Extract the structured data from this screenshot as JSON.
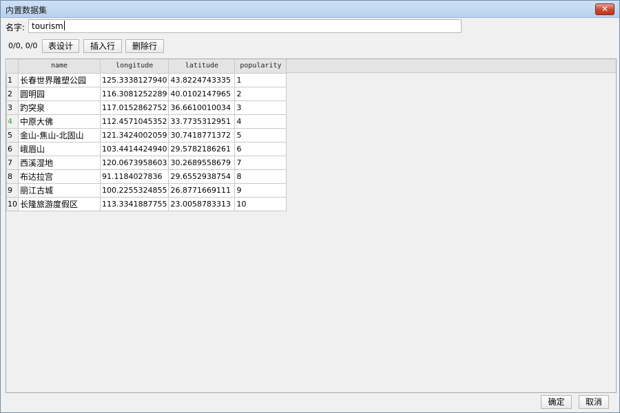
{
  "window": {
    "title": "内置数据集",
    "close_label": "✕"
  },
  "name_field": {
    "label": "名字:",
    "value": "tourism"
  },
  "toolbar": {
    "coords": "0/0, 0/0",
    "table_design": "表设计",
    "insert_row": "插入行",
    "delete_row": "删除行"
  },
  "table": {
    "columns": [
      "name",
      "longitude",
      "latitude",
      "popularity"
    ],
    "rows": [
      {
        "index": "1",
        "name": "长春世界雕塑公园",
        "longitude": "125.3338127940",
        "latitude": "43.8224743335",
        "popularity": "1"
      },
      {
        "index": "2",
        "name": "圆明园",
        "longitude": "116.3081252289",
        "latitude": "40.0102147965",
        "popularity": "2"
      },
      {
        "index": "3",
        "name": "趵突泉",
        "longitude": "117.0152862752",
        "latitude": "36.6610010034",
        "popularity": "3"
      },
      {
        "index": "4",
        "name": "中原大佛",
        "longitude": "112.4571045352",
        "latitude": "33.7735312951",
        "popularity": "4"
      },
      {
        "index": "5",
        "name": "金山-焦山-北固山",
        "longitude": "121.3424002059",
        "latitude": "30.7418771372",
        "popularity": "5"
      },
      {
        "index": "6",
        "name": "峨眉山",
        "longitude": "103.4414424940",
        "latitude": "29.5782186261",
        "popularity": "6"
      },
      {
        "index": "7",
        "name": "西溪湿地",
        "longitude": "120.0673958603",
        "latitude": "30.2689558679",
        "popularity": "7"
      },
      {
        "index": "8",
        "name": "布达拉宫",
        "longitude": "91.1184027836",
        "latitude": "29.6552938754",
        "popularity": "8"
      },
      {
        "index": "9",
        "name": "丽江古城",
        "longitude": "100.2255324855",
        "latitude": "26.8771669111",
        "popularity": "9"
      },
      {
        "index": "10",
        "name": "长隆旅游度假区",
        "longitude": "113.3341887755",
        "latitude": "23.0058783313",
        "popularity": "10"
      }
    ]
  },
  "footer": {
    "ok": "确定",
    "cancel": "取消"
  },
  "colors": {
    "digit_highlight": "#3aa040",
    "title_bar": "#c3d8f1",
    "close": "#c9462c"
  }
}
